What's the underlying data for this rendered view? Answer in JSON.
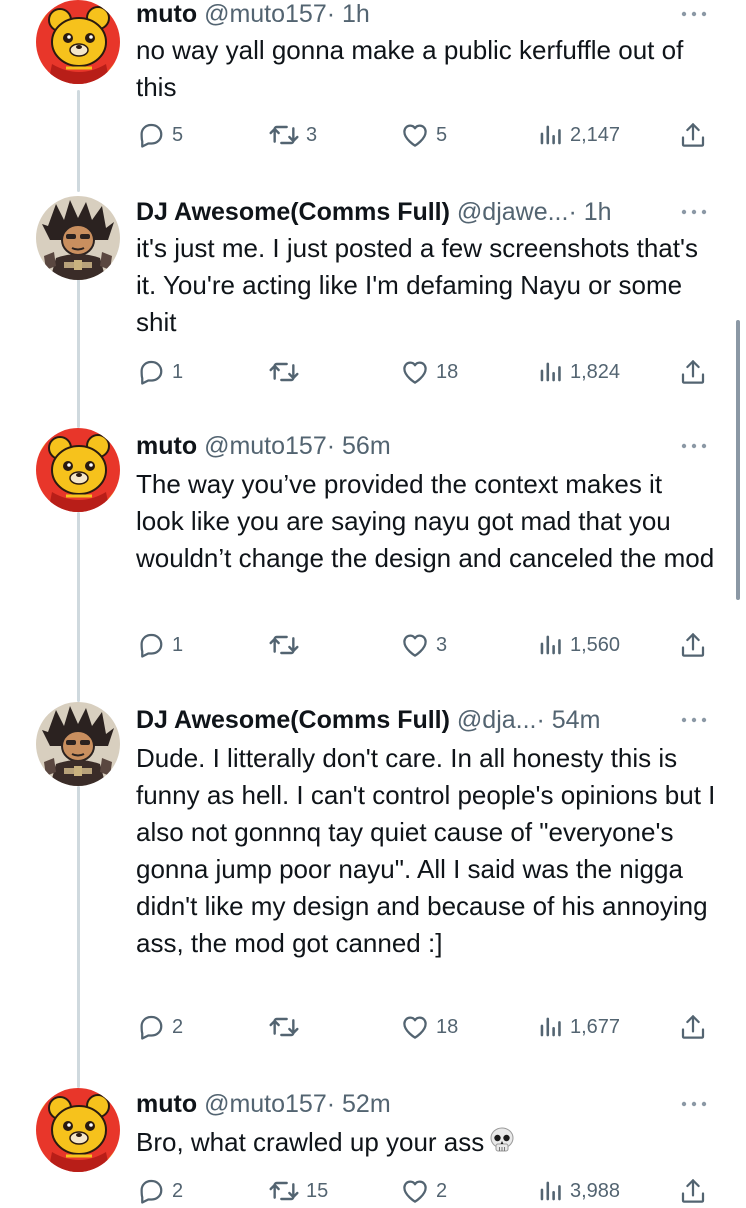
{
  "tweets": [
    {
      "name": "muto",
      "handle": "@muto157",
      "time": "· 1h",
      "text": "no way yall gonna make a public kerfuffle out of this",
      "replies": "5",
      "retweets": "3",
      "likes": "5",
      "views": "2,147",
      "avatar": "yellow-bear-avatar"
    },
    {
      "name": "DJ Awesome(Comms Full)",
      "handle": "@djawe...",
      "time": "· 1h",
      "text": "it's just me. I just posted a few screenshots that's it. You're acting like I'm defaming Nayu or some shit",
      "replies": "1",
      "retweets": "",
      "likes": "18",
      "views": "1,824",
      "avatar": "dark-character-avatar"
    },
    {
      "name": "muto",
      "handle": "@muto157",
      "time": "· 56m",
      "text": "The way you’ve provided the context makes it look like you are saying nayu got mad that you wouldn’t change the design and canceled the mod",
      "replies": "1",
      "retweets": "",
      "likes": "3",
      "views": "1,560",
      "avatar": "yellow-bear-avatar"
    },
    {
      "name": "DJ Awesome(Comms Full)",
      "handle": "@dja...",
      "time": "· 54m",
      "text": "Dude. I litterally don't care. In all honesty this is funny as hell. I can't control people's opinions but I also not gonnnq tay quiet cause of \"everyone's gonna jump poor nayu\". All I said was the nigga didn't like my design and because of his annoying ass, the mod got canned :]",
      "replies": "2",
      "retweets": "",
      "likes": "18",
      "views": "1,677",
      "avatar": "dark-character-avatar"
    },
    {
      "name": "muto",
      "handle": "@muto157",
      "time": "· 52m",
      "text": "Bro, what crawled up your ass",
      "emoji": "skull-emoji",
      "replies": "2",
      "retweets": "15",
      "likes": "2",
      "views": "3,988",
      "avatar": "yellow-bear-avatar"
    }
  ],
  "icons": {
    "reply": "reply-icon",
    "retweet": "retweet-icon",
    "like": "heart-icon",
    "views": "views-icon",
    "share": "share-icon",
    "more": "more-icon"
  },
  "colors": {
    "text": "#0f1419",
    "secondary": "#536471",
    "thread_line": "#cfd9de"
  }
}
